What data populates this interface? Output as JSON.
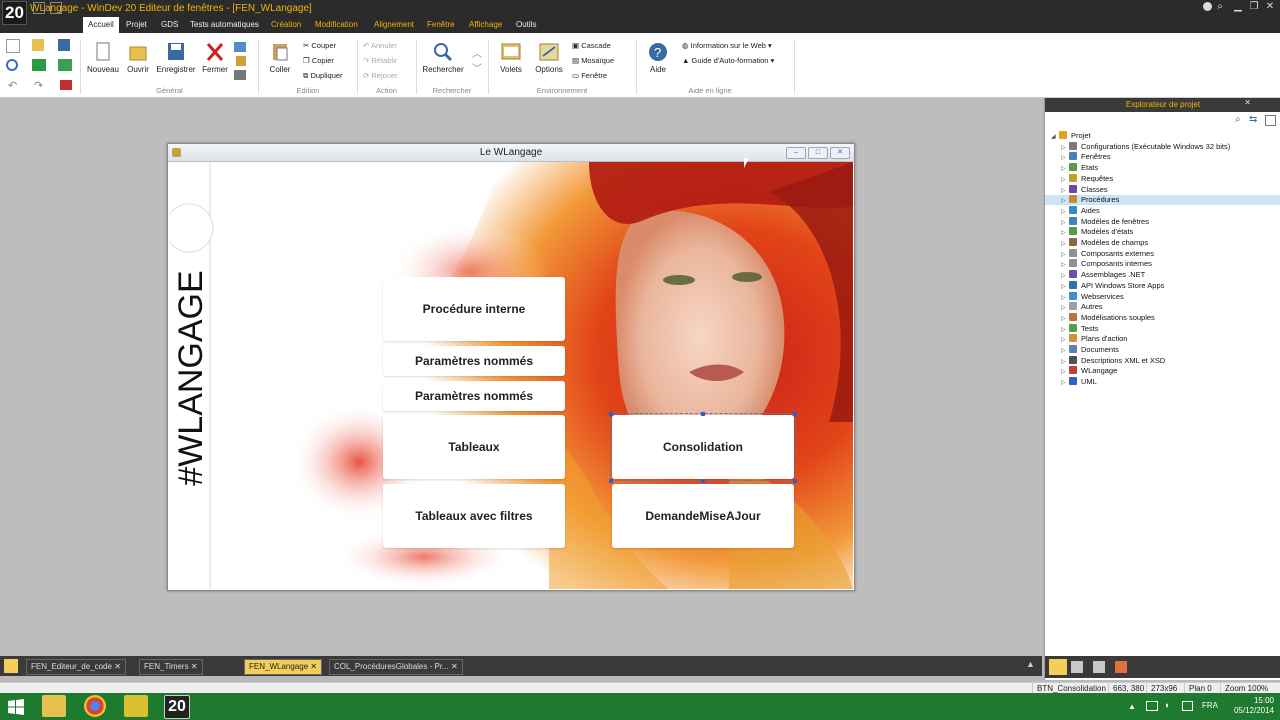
{
  "app": {
    "logo_text": "20",
    "title": "WLangage - WinDev 20  Editeur de fenêtres - [FEN_WLangage]",
    "icons": [
      "minimize-icon",
      "restore-icon",
      "close-icon"
    ]
  },
  "ribbon_tabs": [
    {
      "label": "Accueil",
      "active": true
    },
    {
      "label": "Projet"
    },
    {
      "label": "GDS"
    },
    {
      "label": "Tests automatiques"
    },
    {
      "label": "Création"
    },
    {
      "label": "Modification"
    },
    {
      "label": "Alignement"
    },
    {
      "label": "Fenêtre"
    },
    {
      "label": "Affichage"
    },
    {
      "label": "Outils"
    }
  ],
  "ribbon": {
    "general": {
      "nouveau": "Nouveau",
      "ouvrir": "Ouvrir",
      "enregistrer": "Enregistrer",
      "fermer": "Fermer",
      "group": "Général"
    },
    "edition": {
      "coller": "Coller",
      "couper": "Couper",
      "copier": "Copier",
      "dupliquer": "Dupliquer",
      "group": "Edition"
    },
    "action": {
      "annuler": "Annuler",
      "retablir": "Rétablir",
      "rejouer": "Rejouer",
      "group": "Action"
    },
    "rechercher": {
      "label": "Rechercher",
      "group": "Rechercher"
    },
    "environnement": {
      "volets": "Volets",
      "options": "Options",
      "cascade": "Cascade",
      "mosaique": "Mosaïque",
      "fenetre": "Fenêtre",
      "group": "Environnement"
    },
    "aide": {
      "aide": "Aide",
      "info_web": "Information sur le Web",
      "guide": "Guide d'Auto-formation",
      "group": "Aide en ligne"
    }
  },
  "designer": {
    "window_title": "Le WLangage",
    "side_text": "#WLANGAGE",
    "buttons": {
      "procedure_interne": "Procédure interne",
      "parametres_nommes_1": "Paramètres nommés",
      "parametres_nommes_2": "Paramètres nommés",
      "tableaux": "Tableaux",
      "tableaux_filtres": "Tableaux avec filtres",
      "consolidation": "Consolidation",
      "demande_mise_a_jour": "DemandeMiseAJour"
    }
  },
  "explorer": {
    "title": "Explorateur de projet",
    "items": [
      {
        "label": "Projet",
        "level": 0,
        "color": "#e0a020"
      },
      {
        "label": "Configurations (Exécutable Windows 32 bits)",
        "level": 1,
        "color": "#7a7a7a"
      },
      {
        "label": "Fenêtres",
        "level": 1,
        "color": "#4a7fc0"
      },
      {
        "label": "Etats",
        "level": 1,
        "color": "#5a9a4a"
      },
      {
        "label": "Requêtes",
        "level": 1,
        "color": "#c0a030"
      },
      {
        "label": "Classes",
        "level": 1,
        "color": "#6a4aa0"
      },
      {
        "label": "Procédures",
        "level": 1,
        "color": "#c09030",
        "selected": true
      },
      {
        "label": "Aides",
        "level": 1,
        "color": "#3a8ac0"
      },
      {
        "label": "Modèles de fenêtres",
        "level": 1,
        "color": "#4a7fc0"
      },
      {
        "label": "Modèles d'états",
        "level": 1,
        "color": "#5a9a4a"
      },
      {
        "label": "Modèles de champs",
        "level": 1,
        "color": "#8a6a40"
      },
      {
        "label": "Composants externes",
        "level": 1,
        "color": "#909090"
      },
      {
        "label": "Composants internes",
        "level": 1,
        "color": "#909090"
      },
      {
        "label": "Assemblages .NET",
        "level": 1,
        "color": "#7050a0"
      },
      {
        "label": "API Windows Store Apps",
        "level": 1,
        "color": "#3070b0"
      },
      {
        "label": "Webservices",
        "level": 1,
        "color": "#4090d0"
      },
      {
        "label": "Autres",
        "level": 1,
        "color": "#a0a0a0"
      },
      {
        "label": "Modélisations souples",
        "level": 1,
        "color": "#c07040"
      },
      {
        "label": "Tests",
        "level": 1,
        "color": "#50a050"
      },
      {
        "label": "Plans d'action",
        "level": 1,
        "color": "#d09040"
      },
      {
        "label": "Documents",
        "level": 1,
        "color": "#6080b0"
      },
      {
        "label": "Descriptions XML et XSD",
        "level": 1,
        "color": "#505050"
      },
      {
        "label": "WLangage",
        "level": 1,
        "color": "#c04040"
      },
      {
        "label": "UML",
        "level": 1,
        "color": "#3060c0"
      }
    ]
  },
  "doc_tabs": [
    {
      "label": "FEN_Editeur_de_code"
    },
    {
      "label": "FEN_Timers"
    },
    {
      "label": "FEN_WLangage",
      "active": true
    },
    {
      "label": "COL_ProcéduresGlobales - Pr..."
    }
  ],
  "status": {
    "control": "BTN_Consolidation",
    "position": "663, 380",
    "size": "273x96",
    "plan": "Plan 0",
    "zoom": "Zoom 100%"
  },
  "taskbar": {
    "lang": "FRA",
    "time": "15:00",
    "date": "05/12/2014"
  }
}
